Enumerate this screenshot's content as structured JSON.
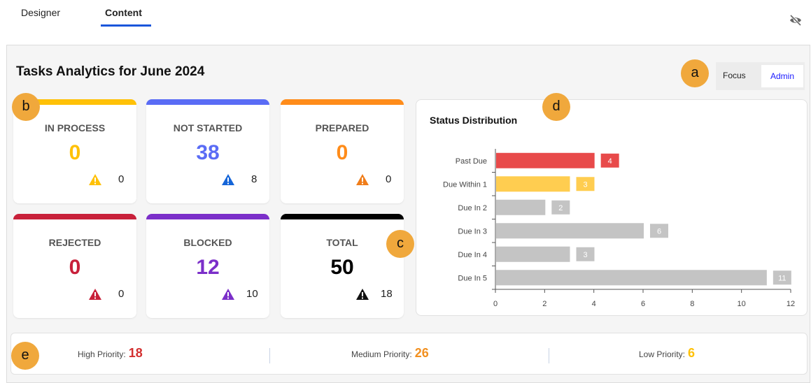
{
  "tabs": [
    {
      "label": "Designer"
    },
    {
      "label": "Content"
    }
  ],
  "header": {
    "title": "Tasks Analytics for June 2024",
    "mode_focus": "Focus",
    "mode_admin": "Admin"
  },
  "markers": {
    "a": "a",
    "b": "b",
    "c": "c",
    "d": "d",
    "e": "e"
  },
  "cards": [
    {
      "label": "IN PROCESS",
      "value": "0",
      "warn_count": "0",
      "color": "#ffc107"
    },
    {
      "label": "NOT STARTED",
      "value": "38",
      "warn_count": "8",
      "color": "#5a6cf5"
    },
    {
      "label": "PREPARED",
      "value": "0",
      "warn_count": "0",
      "color": "#ff8c1a"
    },
    {
      "label": "REJECTED",
      "value": "0",
      "warn_count": "0",
      "color": "#c8203a"
    },
    {
      "label": "BLOCKED",
      "value": "12",
      "warn_count": "10",
      "color": "#7b2fc9"
    },
    {
      "label": "TOTAL",
      "value": "50",
      "warn_count": "18",
      "color": "#000000"
    }
  ],
  "chart_data": {
    "type": "bar",
    "orientation": "horizontal",
    "title": "Status Distribution",
    "categories": [
      "Past Due",
      "Due Within 1",
      "Due In 2",
      "Due In 3",
      "Due In 4",
      "Due In 5"
    ],
    "values": [
      4,
      3,
      2,
      6,
      3,
      11
    ],
    "colors": [
      "#e84a4a",
      "#ffcd50",
      "#c4c4c4",
      "#c4c4c4",
      "#c4c4c4",
      "#c4c4c4"
    ],
    "xlim": [
      0,
      12
    ],
    "xticks": [
      0,
      2,
      4,
      6,
      8,
      10,
      12
    ],
    "grid": false
  },
  "priority": [
    {
      "label": "High Priority:",
      "value": "18",
      "color": "#d32f2f"
    },
    {
      "label": "Medium Priority:",
      "value": "26",
      "color": "#f29020"
    },
    {
      "label": "Low Priority:",
      "value": "6",
      "color": "#ffc107"
    }
  ],
  "icons": {
    "hide": "eye-slash-icon",
    "warning": "warning-triangle-icon"
  }
}
